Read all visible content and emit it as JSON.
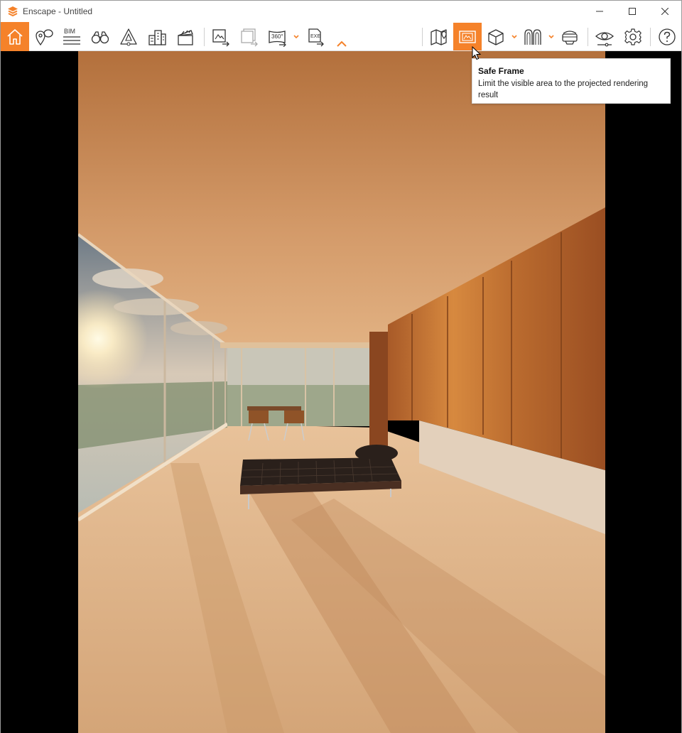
{
  "window": {
    "title": "Enscape - Untitled"
  },
  "colors": {
    "accent": "#f5822a",
    "icon": "#333333"
  },
  "toolbar": {
    "buttons": [
      {
        "name": "home",
        "icon": "home-icon",
        "active": true
      },
      {
        "name": "views",
        "icon": "location-comment-icon"
      },
      {
        "name": "bim",
        "icon": "bim-icon",
        "label": "BIM"
      },
      {
        "name": "explore",
        "icon": "binoculars-icon"
      },
      {
        "name": "asset",
        "icon": "asset-icon"
      },
      {
        "name": "buildings",
        "icon": "buildings-icon"
      },
      {
        "name": "video",
        "icon": "clapperboard-icon"
      },
      {
        "name": "screenshot",
        "icon": "export-image-icon"
      },
      {
        "name": "batch",
        "icon": "batch-export-icon"
      },
      {
        "name": "panorama",
        "icon": "panorama-icon",
        "label": "360°"
      },
      {
        "name": "exe",
        "icon": "exe-export-icon",
        "label": "EXE"
      },
      {
        "name": "map",
        "icon": "map-icon"
      },
      {
        "name": "safe-frame",
        "icon": "safe-frame-icon",
        "active": true
      },
      {
        "name": "cube",
        "icon": "cube-icon"
      },
      {
        "name": "library",
        "icon": "arches-icon"
      },
      {
        "name": "vr",
        "icon": "vr-headset-icon"
      },
      {
        "name": "visual-settings",
        "icon": "eye-icon"
      },
      {
        "name": "settings",
        "icon": "gear-icon"
      },
      {
        "name": "help",
        "icon": "help-icon"
      }
    ]
  },
  "tooltip": {
    "title": "Safe Frame",
    "description": "Limit the visible area to the projected rendering result"
  }
}
